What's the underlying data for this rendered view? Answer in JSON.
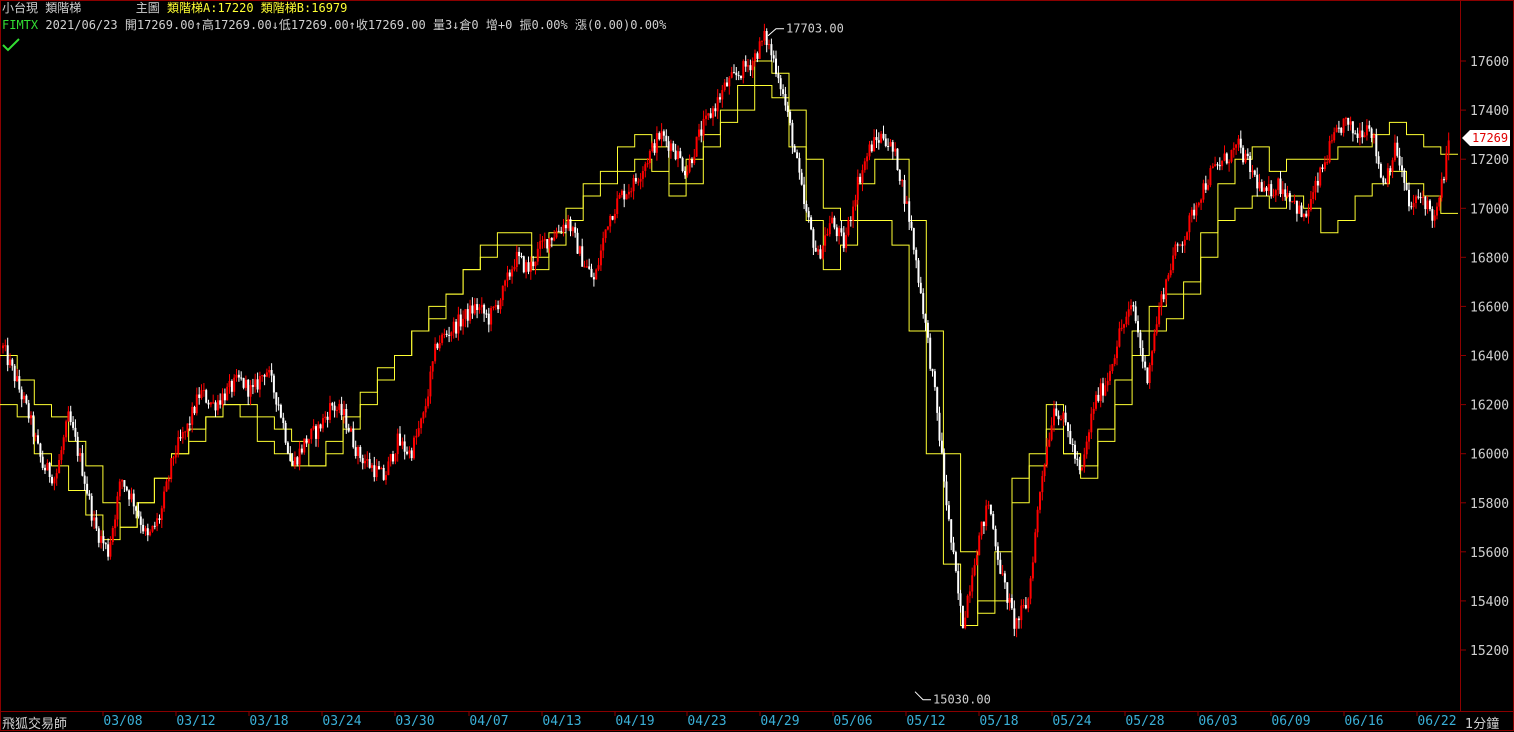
{
  "header": {
    "product": "小台現",
    "indicator": "類階梯",
    "pane": "主圖",
    "ladder_a_label": "類階梯A:",
    "ladder_a_value": "17220",
    "ladder_b_label": "類階梯B:",
    "ladder_b_value": "16979",
    "symbol": "FIMTX",
    "date": "2021/06/23",
    "ohlc_text": "開17269.00↑高17269.00↓低17269.00↑收17269.00",
    "volume_text": "量3↓倉0",
    "change_text": "增+0 振0.00% 漲(0.00)0.00%"
  },
  "footer": {
    "brand": "飛狐交易師",
    "period": "1分鐘"
  },
  "colors": {
    "background": "#000000",
    "frame": "#8b0000",
    "candle_up": "#ff0000",
    "candle_down": "#ffffff",
    "ladder": "#ffff33",
    "axis_text": "#d0d0d0",
    "date_text": "#3ab0d8",
    "price_tag_text": "#e00000"
  },
  "chart_data": {
    "type": "line",
    "subtype": "candlestick_with_ladder",
    "grid": false,
    "y_axis_side": "right",
    "ylim": [
      15030,
      17703
    ],
    "y_ticks": [
      17600,
      17400,
      17200,
      17000,
      16800,
      16600,
      16400,
      16200,
      16000,
      15800,
      15600,
      15400,
      15200
    ],
    "x_ticks": [
      "03/08",
      "03/12",
      "03/18",
      "03/24",
      "03/30",
      "04/07",
      "04/13",
      "04/19",
      "04/23",
      "04/29",
      "05/06",
      "05/12",
      "05/18",
      "05/24",
      "05/28",
      "06/03",
      "06/09",
      "06/16",
      "06/22"
    ],
    "last_price": "17269",
    "annotations": [
      {
        "text": "17703.00",
        "value": 17703,
        "x_date": "04/27"
      },
      {
        "text": "15030.00",
        "value": 15030,
        "x_date": "05/12"
      }
    ],
    "price_path": [
      16430,
      16300,
      16150,
      15950,
      15900,
      16150,
      15950,
      15700,
      15600,
      15900,
      15800,
      15650,
      15750,
      16000,
      16100,
      16250,
      16200,
      16250,
      16300,
      16250,
      16350,
      16200,
      15950,
      16050,
      16100,
      16200,
      16150,
      16000,
      15950,
      15900,
      16050,
      16000,
      16150,
      16450,
      16500,
      16550,
      16600,
      16550,
      16650,
      16800,
      16750,
      16850,
      16900,
      16950,
      16800,
      16700,
      16950,
      17050,
      17100,
      17200,
      17300,
      17250,
      17150,
      17300,
      17400,
      17500,
      17550,
      17600,
      17700,
      17550,
      17300,
      17000,
      16800,
      16950,
      16850,
      17100,
      17250,
      17300,
      17200,
      16950,
      16600,
      16200,
      15700,
      15300,
      15600,
      15800,
      15500,
      15300,
      15400,
      15900,
      16200,
      16100,
      15900,
      16200,
      16300,
      16500,
      16600,
      16300,
      16600,
      16800,
      16900,
      17050,
      17150,
      17200,
      17250,
      17150,
      17050,
      17100,
      17050,
      16950,
      17100,
      17250,
      17350,
      17300,
      17350,
      17100,
      17250,
      17000,
      17050,
      16950,
      17250
    ],
    "ladder_a": [
      16400,
      16300,
      16200,
      16150,
      16050,
      15950,
      15800,
      15700,
      15800,
      15900,
      16000,
      16100,
      16150,
      16200,
      16200,
      16150,
      16100,
      16050,
      15950,
      16000,
      16100,
      16200,
      16300,
      16400,
      16500,
      16600,
      16650,
      16750,
      16850,
      16900,
      16900,
      16800,
      16900,
      17000,
      17100,
      17150,
      17250,
      17300,
      17250,
      17100,
      17200,
      17300,
      17400,
      17500,
      17600,
      17550,
      17400,
      17200,
      17000,
      16950,
      17100,
      17200,
      17200,
      16950,
      16500,
      16000,
      15600,
      15350,
      15400,
      15900,
      16000,
      16200,
      16000,
      15950,
      16100,
      16300,
      16500,
      16600,
      16650,
      16700,
      16900,
      17100,
      17200,
      17250,
      17150,
      17200,
      17200,
      17200,
      17250,
      17250,
      17300,
      17350,
      17300,
      17250,
      17220
    ],
    "ladder_b": [
      16200,
      16150,
      16000,
      15950,
      15850,
      15750,
      15650,
      15700,
      15800,
      15900,
      16000,
      16050,
      16150,
      16200,
      16150,
      16050,
      16000,
      15950,
      15950,
      16050,
      16150,
      16250,
      16350,
      16400,
      16500,
      16550,
      16650,
      16750,
      16800,
      16850,
      16850,
      16750,
      16850,
      16950,
      17050,
      17100,
      17150,
      17200,
      17150,
      17050,
      17100,
      17250,
      17350,
      17400,
      17500,
      17450,
      17250,
      16950,
      16750,
      16850,
      16950,
      16950,
      16850,
      16500,
      16000,
      15550,
      15300,
      15400,
      15600,
      15800,
      15950,
      16100,
      16000,
      15900,
      16050,
      16200,
      16400,
      16500,
      16550,
      16650,
      16800,
      16950,
      17000,
      17050,
      17000,
      17050,
      17000,
      16900,
      16950,
      17050,
      17100,
      17150,
      17100,
      17050,
      16979
    ]
  }
}
